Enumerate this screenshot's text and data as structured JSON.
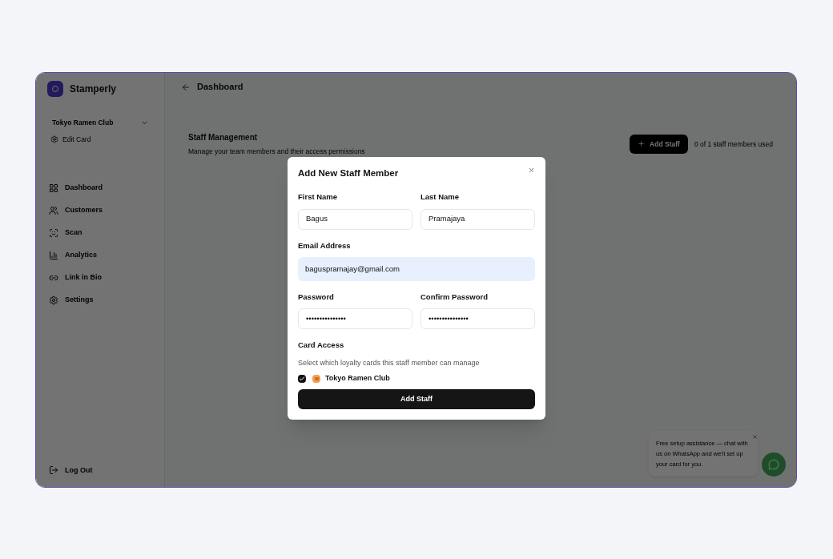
{
  "brand": {
    "name": "Stamperly"
  },
  "card_selector": {
    "label": "Tokyo Ramen Club"
  },
  "card_menu": [
    {
      "label": "Edit Card"
    }
  ],
  "nav": [
    {
      "label": "Dashboard"
    },
    {
      "label": "Customers"
    },
    {
      "label": "Scan"
    },
    {
      "label": "Analytics"
    },
    {
      "label": "Link in Bio"
    },
    {
      "label": "Settings"
    }
  ],
  "logout": {
    "label": "Log Out"
  },
  "header": {
    "title": "Dashboard"
  },
  "staff": {
    "title": "Staff Management",
    "subtitle": "Manage your team members and their access permissions",
    "add_button": "Add Staff",
    "usage": "0 of 1 staff members used"
  },
  "dialog": {
    "title": "Add New Staff Member",
    "fields": [
      {
        "label": "First Name",
        "value": "Bagus",
        "focused": false
      },
      {
        "label": "Last Name",
        "value": "Pramajaya",
        "focused": false
      },
      {
        "label": "Email Address",
        "value": "baguspramajay@gmail.com",
        "focused": true
      },
      {
        "label": "Password",
        "value": "•••••••••••••••",
        "focused": false
      },
      {
        "label": "Confirm Password",
        "value": "•••••••••••••••",
        "focused": false
      }
    ],
    "card_access": {
      "title": "Card Access",
      "hint": "Select which loyalty cards this staff member can manage",
      "cards": [
        {
          "label": "Tokyo Ramen Club",
          "checked": true
        }
      ]
    },
    "submit": "Add Staff"
  },
  "help_popup": {
    "text": "Free setup assistance — chat with us on WhatsApp and we'll set up your card for you."
  }
}
